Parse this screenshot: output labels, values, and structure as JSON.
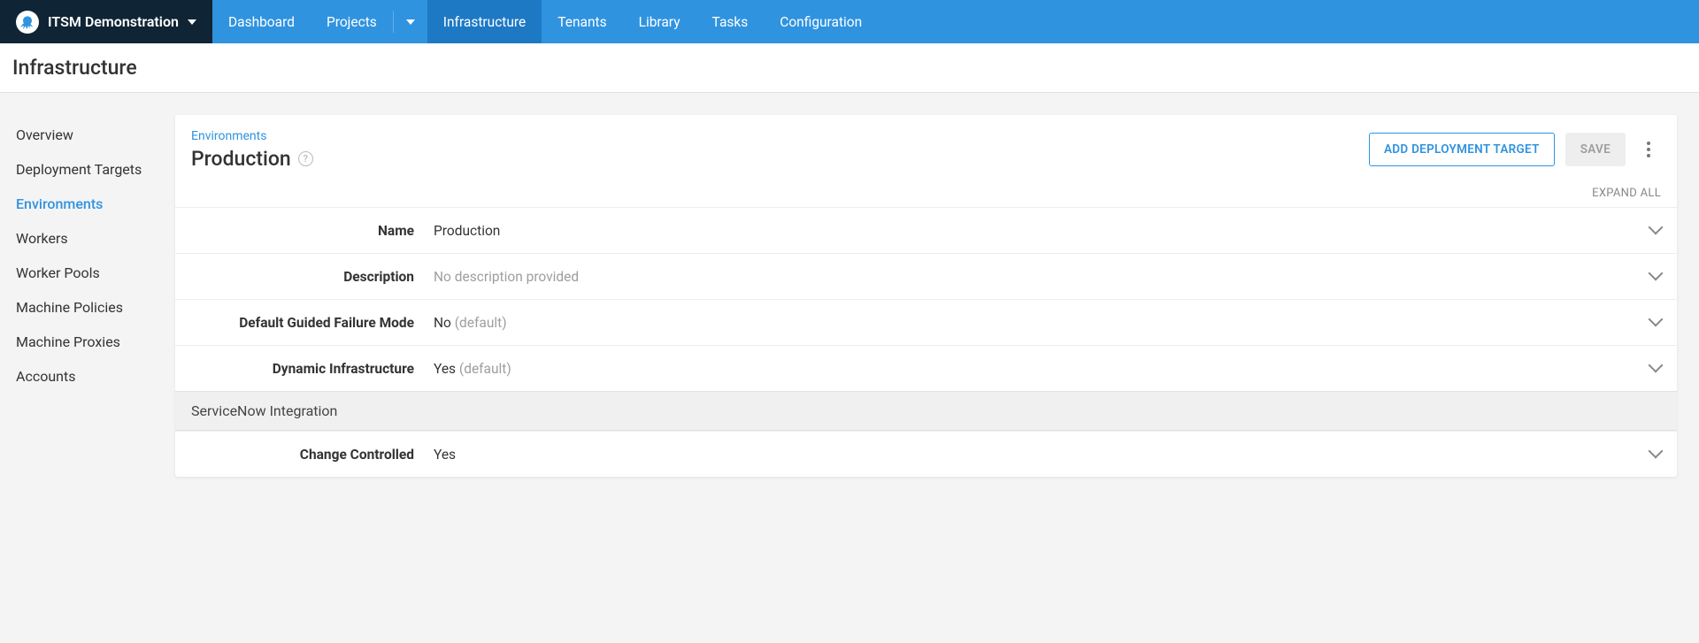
{
  "space": {
    "name": "ITSM Demonstration"
  },
  "nav": {
    "dashboard": "Dashboard",
    "projects": "Projects",
    "infrastructure": "Infrastructure",
    "tenants": "Tenants",
    "library": "Library",
    "tasks": "Tasks",
    "configuration": "Configuration"
  },
  "page": {
    "title": "Infrastructure"
  },
  "sidebar": {
    "overview": "Overview",
    "deployment_targets": "Deployment Targets",
    "environments": "Environments",
    "workers": "Workers",
    "worker_pools": "Worker Pools",
    "machine_policies": "Machine Policies",
    "machine_proxies": "Machine Proxies",
    "accounts": "Accounts"
  },
  "breadcrumb": {
    "environments": "Environments"
  },
  "env": {
    "title": "Production"
  },
  "actions": {
    "add_target": "ADD DEPLOYMENT TARGET",
    "save": "SAVE",
    "expand_all": "EXPAND ALL"
  },
  "props": {
    "name_label": "Name",
    "name_value": "Production",
    "desc_label": "Description",
    "desc_value": "No description provided",
    "guided_label": "Default Guided Failure Mode",
    "guided_value": "No ",
    "guided_suffix": "(default)",
    "dynamic_label": "Dynamic Infrastructure",
    "dynamic_value": "Yes ",
    "dynamic_suffix": "(default)",
    "section_servicenow": "ServiceNow Integration",
    "change_label": "Change Controlled",
    "change_value": "Yes"
  }
}
